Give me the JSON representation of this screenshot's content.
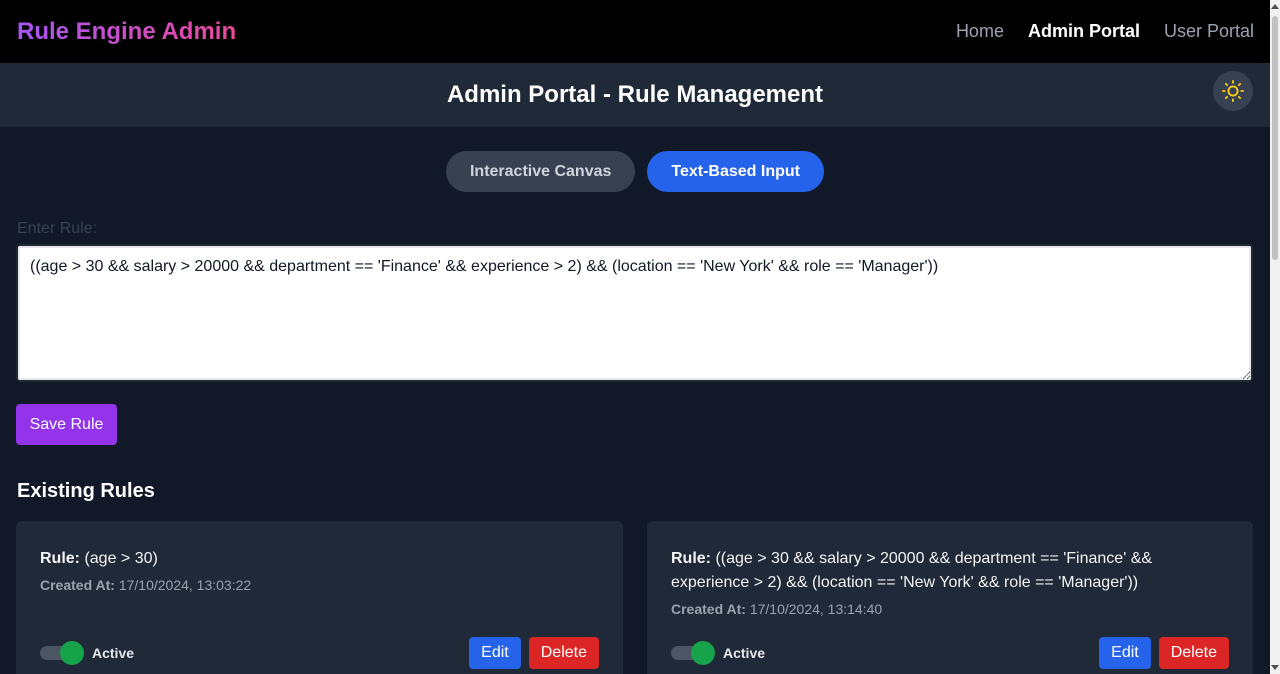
{
  "nav": {
    "brand": "Rule Engine Admin",
    "links": [
      {
        "label": "Home",
        "active": false
      },
      {
        "label": "Admin Portal",
        "active": true
      },
      {
        "label": "User Portal",
        "active": false
      }
    ]
  },
  "header": {
    "title": "Admin Portal - Rule Management",
    "theme_icon": "sun-icon"
  },
  "tabs": [
    {
      "label": "Interactive Canvas",
      "active": false
    },
    {
      "label": "Text-Based Input",
      "active": true
    }
  ],
  "rule_form": {
    "label": "Enter Rule:",
    "value": "((age > 30 && salary > 20000 && department == 'Finance' && experience > 2) && (location == 'New York' && role == 'Manager'))",
    "save_label": "Save Rule"
  },
  "existing": {
    "title": "Existing Rules",
    "rule_prefix": "Rule:",
    "created_prefix": "Created At:",
    "edit_label": "Edit",
    "delete_label": "Delete",
    "rules": [
      {
        "rule": "(age > 30)",
        "created_at": "17/10/2024, 13:03:22",
        "status": "Active",
        "enabled": true
      },
      {
        "rule": "((age > 30 && salary > 20000 && department == 'Finance' && experience > 2) && (location == 'New York' && role == 'Manager'))",
        "created_at": "17/10/2024, 13:14:40",
        "status": "Active",
        "enabled": true
      }
    ]
  },
  "colors": {
    "background": "#111827",
    "primary": "#2563eb",
    "save": "#9333ea",
    "delete": "#dc2626",
    "toggle_on": "#16a34a"
  }
}
